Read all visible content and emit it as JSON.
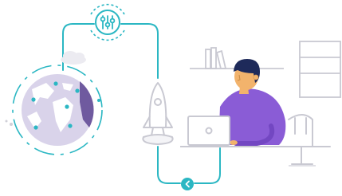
{
  "illustration": {
    "subject": "developer-at-laptop-with-rocket-and-globe",
    "icons": {
      "top_node": "sliders-icon",
      "bottom_node": "chevron-left-icon",
      "launch": "rocket-icon",
      "world": "globe-icon",
      "device": "laptop-icon",
      "person": "person-icon",
      "weather": "cloud-icon"
    },
    "colors": {
      "accent_teal": "#2bb7c3",
      "purple": "#8a5cd6",
      "globe_fill": "#d9d3ea",
      "globe_dark": "#6f5a9f",
      "line_gray": "#c9c9d2",
      "skin": "#f2b36c",
      "hair": "#1e2a5a"
    }
  }
}
